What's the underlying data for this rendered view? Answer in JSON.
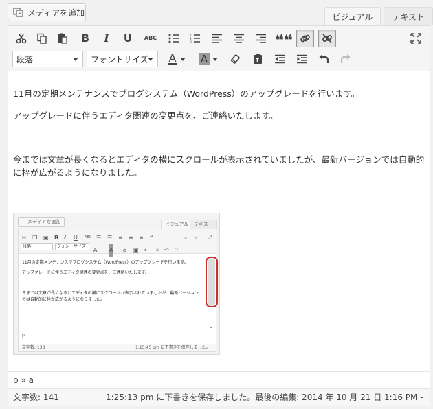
{
  "header": {
    "media_button": "メディアを追加",
    "tabs": [
      "ビジュアル",
      "テキスト"
    ]
  },
  "toolbar": {
    "paragraph_select": "段落",
    "font_size_select": "フォントサイズ",
    "text_color_label": "A",
    "bg_color_label": "A",
    "bold": "B",
    "italic": "I",
    "underline": "U",
    "strike": "ABC",
    "blockquote": "❝❝"
  },
  "content": {
    "line1": "11月の定期メンテナンスでブログシステム（WordPress）のアップグレードを行います。",
    "line2": "アップグレードに伴うエディタ関連の変更点を、ご連絡いたします。",
    "line3": "今までは文章が長くなるとエディタの横にスクロールが表示されていましたが、最新バージョンでは自動的に枠が広がるようになりました。"
  },
  "embedded": {
    "media_button": "メディアを追加",
    "tabs": [
      "ビジュアル",
      "テキスト"
    ],
    "paragraph_select": "段落",
    "font_size_select": "フォントサイズ",
    "line1": "11月の定期メンテナンスでブログシステム（WordPress）のアップグレードを行います。",
    "line2": "アップグレードに伴うエディタ関連の変更点を、ご連絡いたします。",
    "line3": "今までは文章が長くなるとエディタの横にスクロールが表示されていましたが、最新バージョンでは自動的に枠が広がるようになりました。",
    "path": "p",
    "word_count": "文字数: 133",
    "saved": "1:15:45 pm に下書きを保存しました。"
  },
  "path": "p » a",
  "status": {
    "word_count": "文字数: 141",
    "saved": "1:25:13 pm に下書きを保存しました。最後の編集: 2014 年 10 月 21 日 1:16 PM -"
  }
}
